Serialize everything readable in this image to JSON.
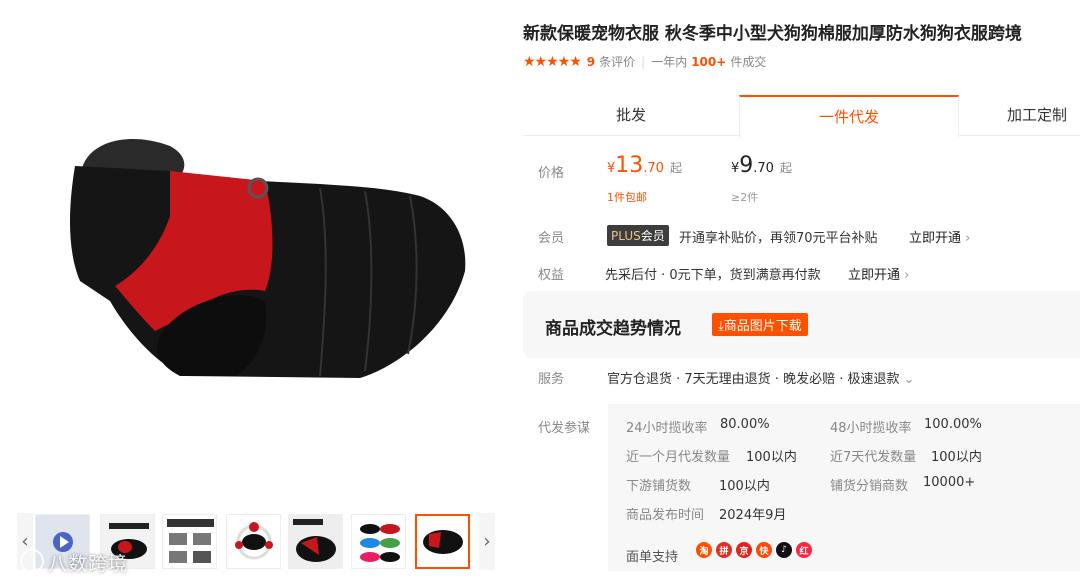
{
  "product": {
    "title": "新款保暖宠物衣服 秋冬季中小型犬狗狗棉服加厚防水狗狗衣服跨境",
    "rating_stars": "★★★★★",
    "review_count": "9",
    "review_label": "条评价",
    "sold_prefix": "一年内",
    "sold_count": "100+",
    "sold_suffix": "件成交"
  },
  "tabs": [
    {
      "label": "批发",
      "active": false
    },
    {
      "label": "一件代发",
      "active": true
    },
    {
      "label": "加工定制",
      "active": false
    }
  ],
  "price": {
    "label": "价格",
    "main": {
      "currency": "¥",
      "integer": "13",
      "decimal": ".70",
      "suffix": "起",
      "note": "1件包邮"
    },
    "alt": {
      "currency": "¥",
      "integer": "9",
      "decimal": ".70",
      "suffix": "起",
      "note": "≥2件"
    }
  },
  "member": {
    "label": "会员",
    "badge_plus": "PLUS",
    "badge_text": "会员",
    "text": "开通享补贴价，再领70元平台补贴",
    "link": "立即开通"
  },
  "benefit": {
    "label": "权益",
    "text": "先采后付 · 0元下单，货到满意再付款",
    "link": "立即开通"
  },
  "trend": {
    "title": "商品成交趋势情况",
    "download_label": "商品图片下载"
  },
  "service": {
    "label": "服务",
    "text": "官方仓退货 · 7天无理由退货 · 晚发必赔 · 极速退款"
  },
  "dropship": {
    "label": "代发参谋",
    "stats": [
      {
        "key": "24小时揽收率",
        "value": "80.00%"
      },
      {
        "key": "48小时揽收率",
        "value": "100.00%"
      },
      {
        "key": "近一个月代发数量",
        "value": "100以内"
      },
      {
        "key": "近7天代发数量",
        "value": "100以内"
      },
      {
        "key": "下游铺货数",
        "value": "100以内"
      },
      {
        "key": "铺货分销商数",
        "value": "10000+"
      },
      {
        "key": "商品发布时间",
        "value": "2024年9月"
      }
    ],
    "platform_label": "面单支持",
    "platforms": [
      "taobao-icon",
      "pinduoduo-icon",
      "jd-icon",
      "kuaishou-icon",
      "douyin-icon",
      "xiaohongshu-icon"
    ]
  },
  "watermark": "八数跨境",
  "colors": {
    "accent": "#ff5000",
    "dark_badge": "#3d3d3d",
    "panel_bg": "#f7f7f8"
  }
}
